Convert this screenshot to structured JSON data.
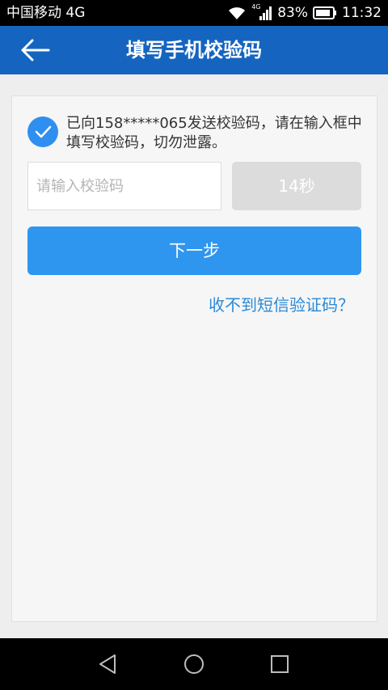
{
  "status_bar": {
    "carrier": "中国移动 4G",
    "network_badge": "4G",
    "battery_percent": "83%",
    "time": "11:32",
    "icons": [
      "wifi-icon",
      "cellular-signal-icon",
      "battery-icon"
    ]
  },
  "nav": {
    "back_icon": "arrow-left-icon",
    "title": "填写手机校验码"
  },
  "verification": {
    "notice": "已向158*****065发送校验码，请在输入框中填写校验码，切勿泄露。",
    "code_input": {
      "placeholder": "请输入校验码",
      "value": ""
    },
    "countdown_label": "14秒",
    "next_label": "下一步",
    "no_sms_link": "收不到短信验证码？"
  },
  "system_nav": {
    "icons": [
      "back-triangle-icon",
      "home-circle-icon",
      "recents-square-icon"
    ]
  },
  "colors": {
    "nav_bar": "#1565c0",
    "primary_button": "#2f96f0",
    "link": "#2a8ad8",
    "disabled_button": "#dcdcdc"
  }
}
